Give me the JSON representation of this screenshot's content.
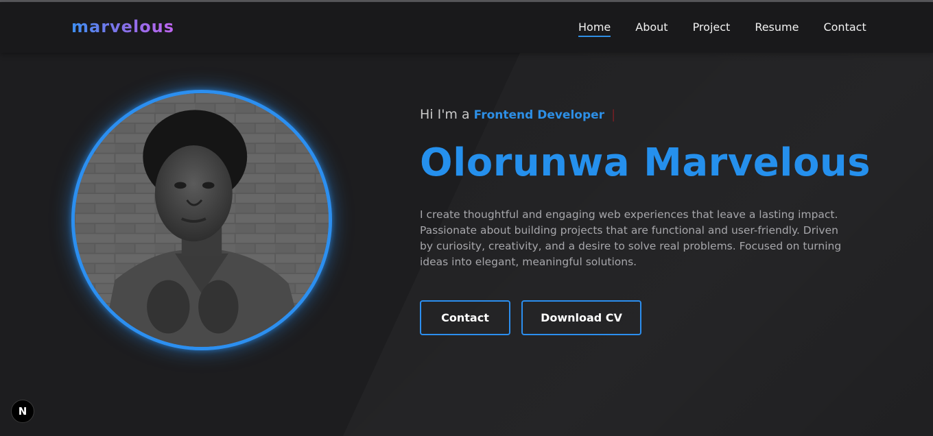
{
  "header": {
    "logo": "marvelous",
    "nav": [
      "Home",
      "About",
      "Project",
      "Resume",
      "Contact"
    ],
    "active_nav": "Home"
  },
  "hero": {
    "greeting_prefix": "Hi I'm a",
    "role": "Frontend Developer",
    "cursor": "|",
    "name": "Olorunwa Marvelous",
    "bio": "I create thoughtful and engaging web experiences that leave a lasting impact. Passionate about building projects that are functional and user-friendly. Driven by curiosity, creativity, and a desire to solve real problems. Focused on turning ideas into elegant, meaningful solutions.",
    "buttons": {
      "contact": "Contact",
      "download_cv": "Download CV"
    }
  },
  "badge": {
    "label": "N"
  },
  "colors": {
    "accent": "#2c8ff0",
    "background": "#1d1d1f",
    "header_bg": "#19191b",
    "text_muted": "#a7a7ab"
  },
  "icons": {
    "badge": "nextjs-logo-icon"
  }
}
